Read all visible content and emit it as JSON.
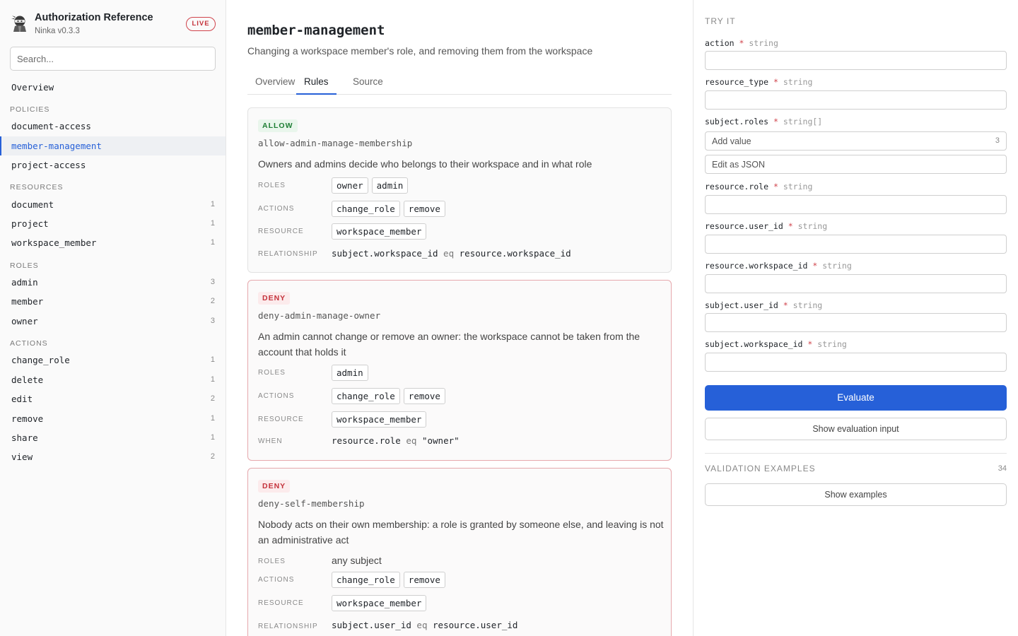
{
  "brand": {
    "title": "Authorization Reference",
    "version": "Ninka v0.3.3",
    "badge": "LIVE"
  },
  "search": {
    "placeholder": "Search..."
  },
  "sidebar": {
    "overview": "Overview",
    "policies_label": "POLICIES",
    "policies": [
      "document-access",
      "member-management",
      "project-access"
    ],
    "resources_label": "RESOURCES",
    "resources": [
      {
        "name": "document",
        "count": "1"
      },
      {
        "name": "project",
        "count": "1"
      },
      {
        "name": "workspace_member",
        "count": "1"
      }
    ],
    "roles_label": "ROLES",
    "roles": [
      {
        "name": "admin",
        "count": "3"
      },
      {
        "name": "member",
        "count": "2"
      },
      {
        "name": "owner",
        "count": "3"
      }
    ],
    "actions_label": "ACTIONS",
    "actions": [
      {
        "name": "change_role",
        "count": "1"
      },
      {
        "name": "delete",
        "count": "1"
      },
      {
        "name": "edit",
        "count": "2"
      },
      {
        "name": "remove",
        "count": "1"
      },
      {
        "name": "share",
        "count": "1"
      },
      {
        "name": "view",
        "count": "2"
      }
    ]
  },
  "main": {
    "title": "member-management",
    "subtitle": "Changing a workspace member's role, and removing them from the workspace",
    "tabs": [
      "Overview",
      "Rules",
      "Source"
    ],
    "active_tab": "Rules"
  },
  "labels": {
    "roles": "ROLES",
    "actions": "ACTIONS",
    "resource": "RESOURCE",
    "relationship": "RELATIONSHIP",
    "when": "WHEN"
  },
  "rules": [
    {
      "effect": "ALLOW",
      "name": "allow-admin-manage-membership",
      "description": "Owners and admins decide who belongs to their workspace and in what role",
      "roles": [
        "owner",
        "admin"
      ],
      "actions": [
        "change_role",
        "remove"
      ],
      "resource": "workspace_member",
      "condition": {
        "left": "subject.workspace_id",
        "op": "eq",
        "right": "resource.workspace_id"
      }
    },
    {
      "effect": "DENY",
      "name": "deny-admin-manage-owner",
      "description": "An admin cannot change or remove an owner: the workspace cannot be taken from the account that holds it",
      "roles": [
        "admin"
      ],
      "actions": [
        "change_role",
        "remove"
      ],
      "resource": "workspace_member",
      "condition": {
        "left": "resource.role",
        "op": "eq",
        "right": "\"owner\""
      }
    },
    {
      "effect": "DENY",
      "name": "deny-self-membership",
      "description": "Nobody acts on their own membership: a role is granted by someone else, and leaving is not an administrative act",
      "roles_text": "any subject",
      "actions": [
        "change_role",
        "remove"
      ],
      "resource": "workspace_member",
      "condition": {
        "left": "subject.user_id",
        "op": "eq",
        "right": "resource.user_id"
      }
    }
  ],
  "try_it": {
    "label": "TRY IT",
    "required_marker": "*",
    "params": [
      {
        "name": "action",
        "type": "string"
      },
      {
        "name": "resource_type",
        "type": "string"
      },
      {
        "name": "subject.roles",
        "type": "string[]",
        "add_placeholder": "Add value",
        "count": "3",
        "json_button": "Edit as JSON"
      },
      {
        "name": "resource.role",
        "type": "string"
      },
      {
        "name": "resource.user_id",
        "type": "string"
      },
      {
        "name": "resource.workspace_id",
        "type": "string"
      },
      {
        "name": "subject.user_id",
        "type": "string"
      },
      {
        "name": "subject.workspace_id",
        "type": "string"
      }
    ],
    "evaluate": "Evaluate",
    "show_input": "Show evaluation input",
    "validation_label": "VALIDATION EXAMPLES",
    "validation_count": "34",
    "show_examples": "Show examples"
  },
  "colors": {
    "accent": "#2660d8",
    "allow": "#1e7e34",
    "deny": "#c4313a"
  }
}
